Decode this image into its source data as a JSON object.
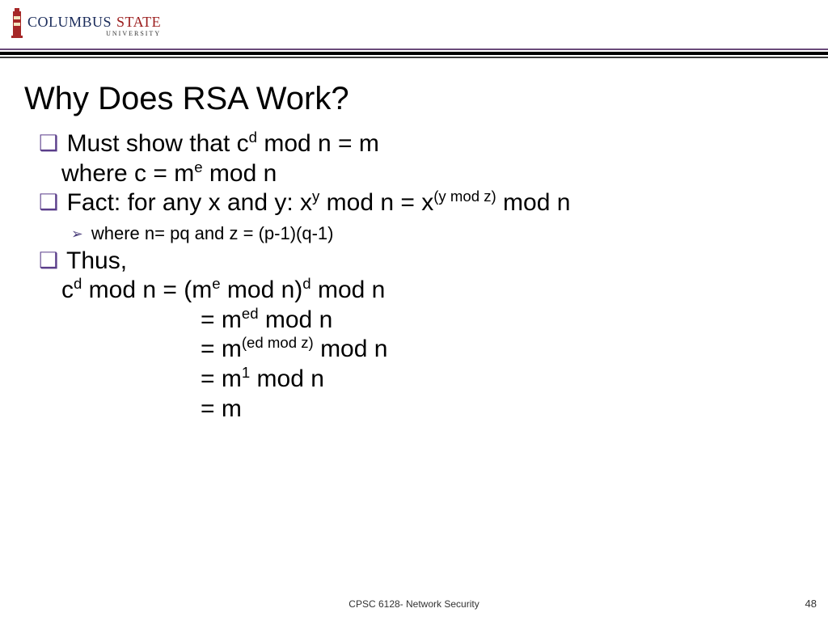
{
  "logo": {
    "word1": "COLUMBUS",
    "word2": "STATE",
    "sub": "UNIVERSITY"
  },
  "title": "Why Does RSA Work?",
  "b1": {
    "lead": "Must show that c",
    "sup1": "d",
    "mid": " mod n = m",
    "line2_a": "where c = m",
    "line2_sup": "e",
    "line2_b": " mod n"
  },
  "b2": {
    "lead": "Fact: for any x and y: x",
    "sup1": "y",
    "mid": " mod n = x",
    "sup2": "(y mod z)",
    "tail": " mod n"
  },
  "sub1": "where n= pq and z = (p-1)(q-1)",
  "b3": {
    "thus": "Thus,",
    "l1_a": "c",
    "l1_s1": "d",
    "l1_b": " mod n = (m",
    "l1_s2": "e",
    "l1_c": " mod n)",
    "l1_s3": "d",
    "l1_d": " mod n",
    "l2_a": "= m",
    "l2_s": "ed",
    "l2_b": " mod n",
    "l3_a": "= m",
    "l3_s": "(ed mod z)",
    "l3_b": " mod n",
    "l4_a": "= m",
    "l4_s": "1",
    "l4_b": " mod n",
    "l5": "= m"
  },
  "footer": "CPSC 6128- Network Security",
  "page": "48"
}
